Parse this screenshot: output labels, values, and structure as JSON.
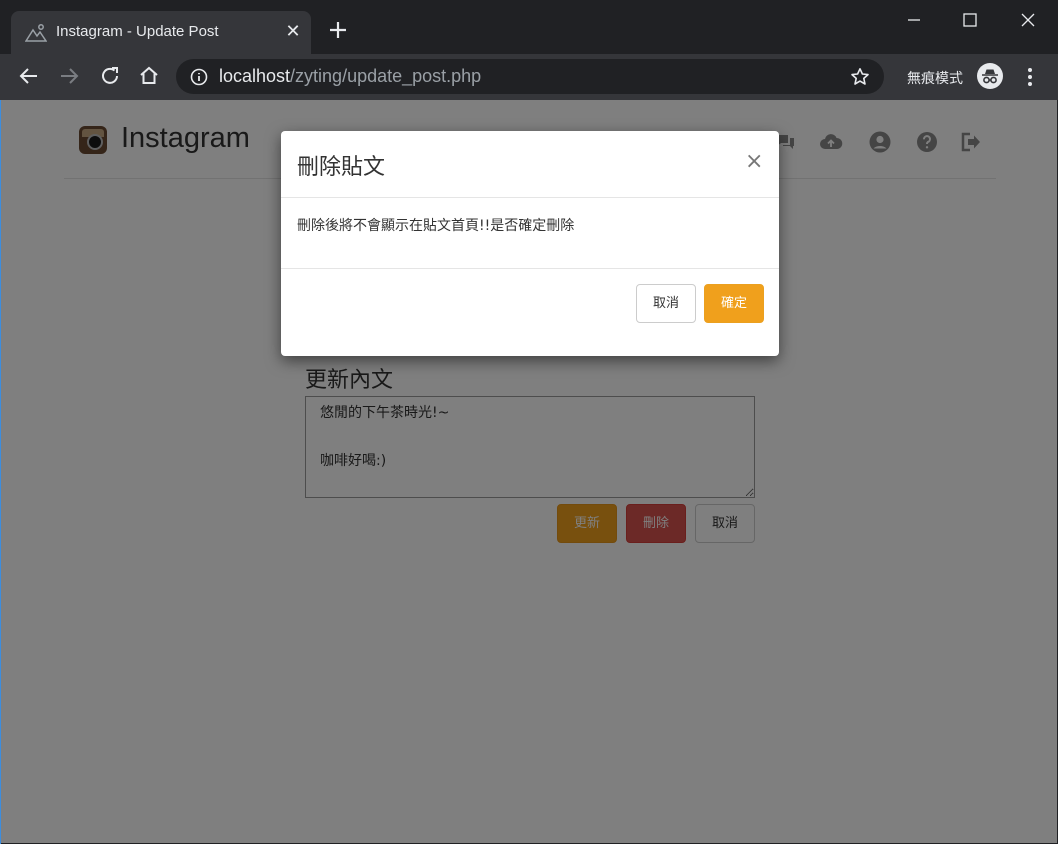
{
  "browser": {
    "tab_title": "Instagram - Update Post",
    "url_host": "localhost",
    "url_path": "/zyting/update_post.php",
    "incognito_label": "無痕模式"
  },
  "page": {
    "brand": "Instagram",
    "nav_icons": [
      "chat-icon",
      "upload-cloud-icon",
      "user-circle-icon",
      "help-icon",
      "logout-icon"
    ],
    "form_title": "更新內文",
    "content_text": "悠閒的下午茶時光!~\n\n咖啡好喝:)",
    "update_label": "更新",
    "delete_label": "刪除",
    "cancel_label": "取消"
  },
  "modal": {
    "title": "刪除貼文",
    "close_label": "×",
    "body": "刪除後將不會顯示在貼文首頁!!是否確定刪除",
    "cancel_label": "取消",
    "confirm_label": "確定"
  },
  "colors": {
    "accent_orange": "#f0a01c",
    "danger_red": "#d9534f",
    "chrome_dark": "#202124",
    "chrome_toolbar": "#35363a"
  }
}
